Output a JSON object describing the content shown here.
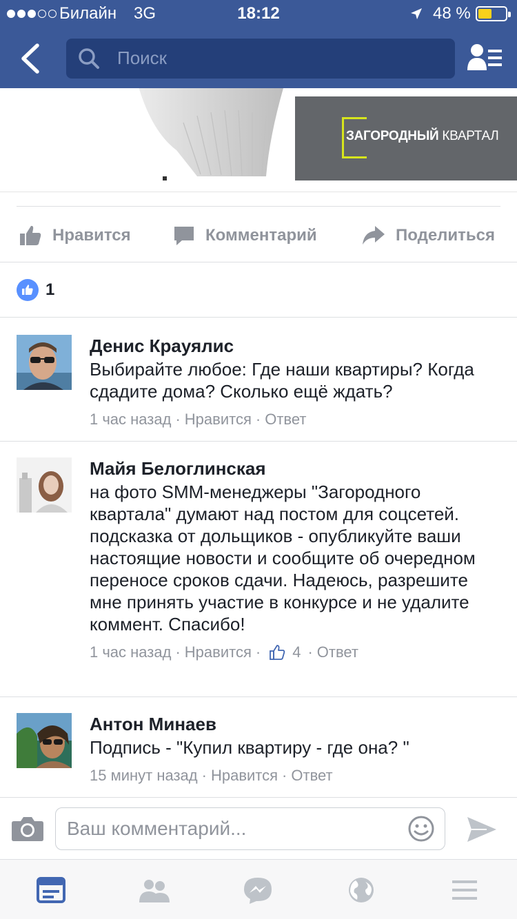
{
  "status_bar": {
    "carrier": "Билайн",
    "network": "3G",
    "time": "18:12",
    "battery": "48 %"
  },
  "nav": {
    "search_placeholder": "Поиск"
  },
  "ad": {
    "brand_bold": "ЗАГОРОДНЫЙ",
    "brand_light": " КВАРТАЛ",
    "logo_color": "#d7e51c"
  },
  "actions": {
    "like": "Нравится",
    "comment": "Комментарий",
    "share": "Поделиться"
  },
  "reactions": {
    "count": "1",
    "color": "#5890ff"
  },
  "comments": [
    {
      "name": "Денис Крауялис",
      "text": "Выбирайте любое: Где наши квартиры? Когда сдадите дома? Сколько ещё ждать?",
      "time": "1 час назад",
      "like": "Нравится",
      "reply": "Ответ"
    },
    {
      "name": "Майя Белоглинская",
      "text": "на фото SMM-менеджеры \"Загородного квартала\" думают над постом для соцсетей. подсказка от дольщиков - опубликуйте ваши настоящие новости и сообщите об очередном переносе сроков сдачи. Надеюсь, разрешите мне принять участие в конкурсе и не удалите коммент. Спасибо!",
      "time": "1 час назад",
      "like": "Нравится",
      "likes_count": "4",
      "reply": "Ответ"
    },
    {
      "name": "Антон Минаев",
      "text": "Подпись - \"Купил квартиру - где она? \"",
      "time": "15 минут назад",
      "like": "Нравится",
      "reply": "Ответ"
    }
  ],
  "composer": {
    "placeholder": "Ваш комментарий..."
  },
  "colors": {
    "header": "#3b5998",
    "search_bg": "#243f79",
    "muted": "#90949c",
    "active_tab": "#4267b2"
  }
}
